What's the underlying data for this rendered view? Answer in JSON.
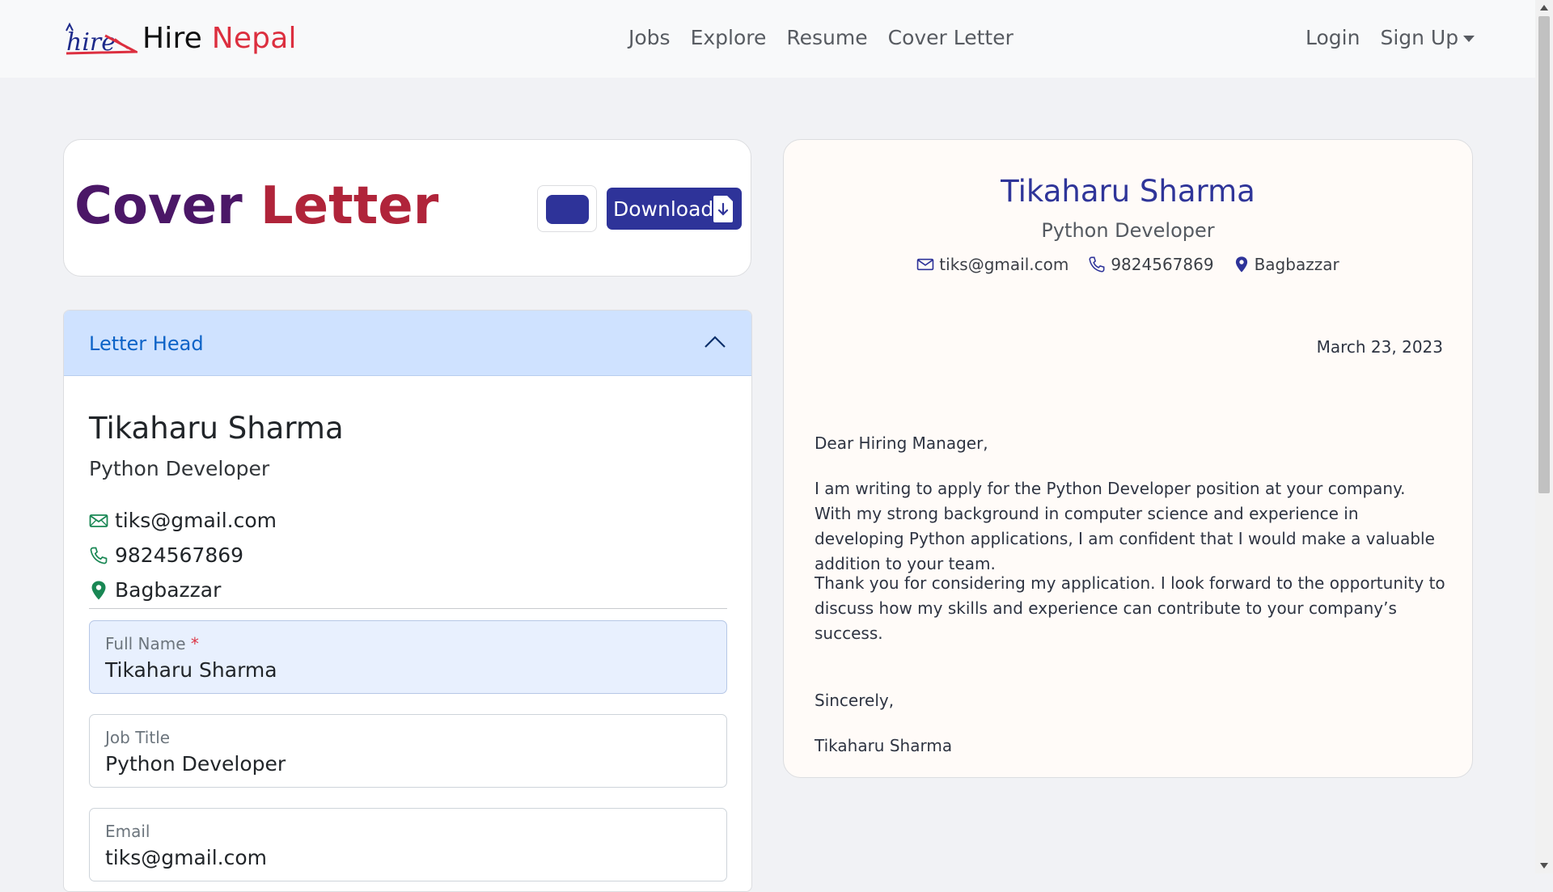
{
  "brand": {
    "hire": "Hire",
    "nepal": "Nepal"
  },
  "nav": {
    "links": [
      "Jobs",
      "Explore",
      "Resume",
      "Cover Letter"
    ],
    "login": "Login",
    "signup": "Sign Up"
  },
  "header": {
    "title_word1": "Cover",
    "title_word2": "Letter",
    "selected_color": "#2e3399",
    "download_label": "Download"
  },
  "form": {
    "section_title": "Letter Head",
    "preview": {
      "name": "Tikaharu Sharma",
      "job": "Python Developer",
      "email": "tiks@gmail.com",
      "phone": "9824567869",
      "location": "Bagbazzar"
    },
    "fields": {
      "full_name": {
        "label": "Full Name",
        "required_mark": "*",
        "value": "Tikaharu Sharma"
      },
      "job_title": {
        "label": "Job Title",
        "value": "Python Developer"
      },
      "email": {
        "label": "Email",
        "value": "tiks@gmail.com"
      }
    }
  },
  "letter": {
    "name": "Tikaharu Sharma",
    "job": "Python Developer",
    "email": "tiks@gmail.com",
    "phone": "9824567869",
    "location": "Bagbazzar",
    "date": "March 23, 2023",
    "greeting": "Dear Hiring Manager,",
    "paragraph1": "I am writing to apply for the Python Developer position at your company. With my strong background in computer science and experience in developing Python applications, I am confident that I would make a valuable addition to your team.",
    "paragraph2": "Thank you for considering my application. I look forward to the opportunity to discuss how my skills and experience can contribute to your company’s success.",
    "closing": "Sincerely,",
    "signature": "Tikaharu Sharma"
  },
  "colors": {
    "accent": "#2e3399",
    "brand_red": "#dc2f3f",
    "title_purple": "#4b1767",
    "title_red": "#b0243a",
    "contact_icon_green": "#198754"
  }
}
